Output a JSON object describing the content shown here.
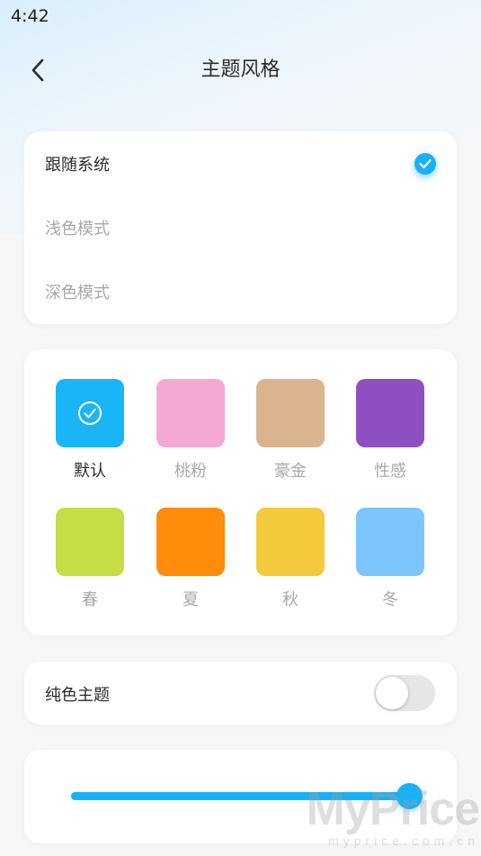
{
  "status_bar": {
    "time": "4:42"
  },
  "header": {
    "title": "主题风格",
    "back_icon": "chevron-left-icon"
  },
  "mode_options": [
    {
      "label": "跟随系统",
      "selected": true
    },
    {
      "label": "浅色模式",
      "selected": false
    },
    {
      "label": "深色模式",
      "selected": false
    }
  ],
  "themes": [
    {
      "label": "默认",
      "color": "#19b5f6",
      "selected": true
    },
    {
      "label": "桃粉",
      "color": "#f4a9d4",
      "selected": false
    },
    {
      "label": "豪金",
      "color": "#d9b48f",
      "selected": false
    },
    {
      "label": "性感",
      "color": "#8e4fc0",
      "selected": false
    },
    {
      "label": "春",
      "color": "#c6dd45",
      "selected": false
    },
    {
      "label": "夏",
      "color": "#ff8c0a",
      "selected": false
    },
    {
      "label": "秋",
      "color": "#f3ca3c",
      "selected": false
    },
    {
      "label": "冬",
      "color": "#7cc6fd",
      "selected": false
    }
  ],
  "solid_theme": {
    "label": "纯色主题",
    "enabled": false
  },
  "slider": {
    "value": 1.0
  },
  "colors": {
    "accent": "#19b1f5"
  },
  "watermark": {
    "main": "MyPrice",
    "sub": "myprice.com.cn"
  }
}
